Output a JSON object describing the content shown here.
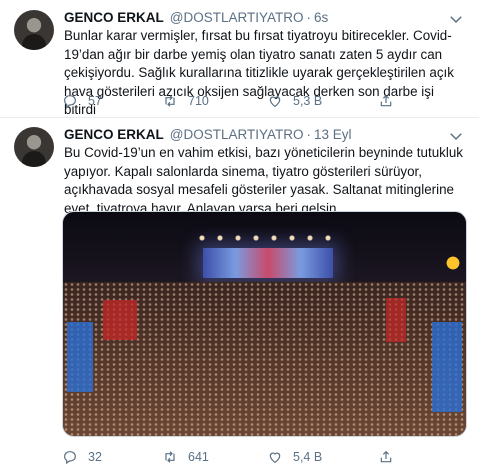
{
  "tweets": [
    {
      "name": "GENCO ERKAL",
      "handle": "@DOSTLARTIYATRO",
      "separator": "·",
      "time": "6s",
      "text": "Bunlar karar vermişler, fırsat bu fırsat tiyatroyu bitirecekler. Covid-19’dan ağır bir darbe yemiş olan tiyatro sanatı zaten 5 aydır can çekişiyordu. Sağlık kurallarına titizlikle uyarak gerçekleştirilen açık hava gösterileri azıcık oksijen sağlayacak derken son darbe işi bitirdi",
      "replies": "57",
      "retweets": "710",
      "likes": "5,3 B"
    },
    {
      "name": "GENCO ERKAL",
      "handle": "@DOSTLARTIYATRO",
      "separator": "·",
      "time": "13 Eyl",
      "text": "Bu Covid-19’un en vahim etkisi, bazı yöneticilerin beyninde tutukluk yapıyor. Kapalı salonlarda sinema, tiyatro gösterileri sürüyor, açıkhavada sosyal mesafeli gösteriler yasak. Saltanat mitinglerine evet, tiyatroya hayır. Anlayan varsa beri gelsin.",
      "replies": "32",
      "retweets": "641",
      "likes": "5,4 B"
    }
  ],
  "icons": {
    "reply": "reply-icon",
    "retweet": "retweet-icon",
    "like": "like-icon",
    "share": "share-icon",
    "caret": "chevron-down-icon"
  },
  "colors": {
    "text": "#0f1419",
    "secondary": "#5b7083",
    "divider": "#e6ecf0"
  }
}
